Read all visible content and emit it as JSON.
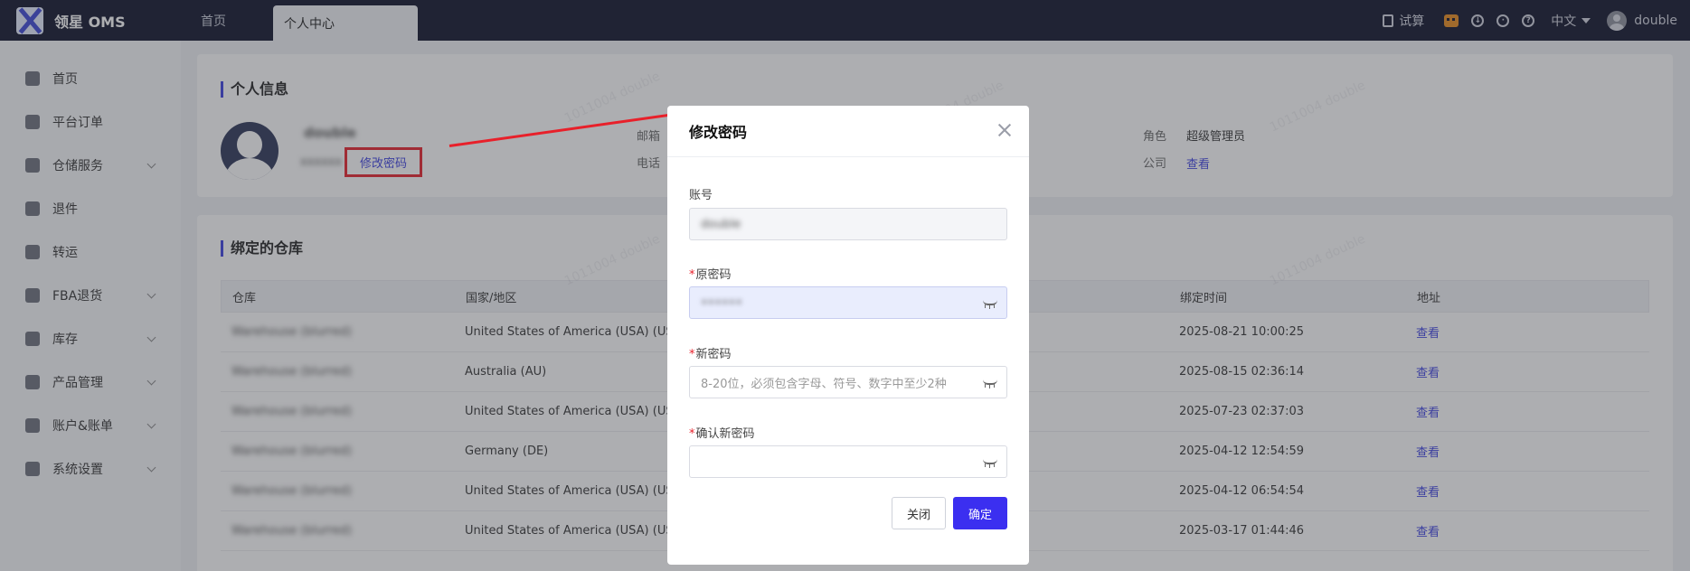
{
  "app": {
    "name": "领星 OMS"
  },
  "tabs": [
    {
      "label": "首页"
    },
    {
      "label": "个人中心"
    }
  ],
  "topbar": {
    "calc": "试算",
    "lang": "中文",
    "user": "double"
  },
  "sidebar": {
    "items": [
      {
        "label": "首页",
        "icon": "home-icon"
      },
      {
        "label": "平台订单",
        "icon": "order-icon"
      },
      {
        "label": "仓储服务",
        "icon": "warehouse-icon"
      },
      {
        "label": "退件",
        "icon": "return-icon"
      },
      {
        "label": "转运",
        "icon": "transfer-icon"
      },
      {
        "label": "FBA退货",
        "icon": "fba-icon"
      },
      {
        "label": "库存",
        "icon": "inventory-icon"
      },
      {
        "label": "产品管理",
        "icon": "product-icon"
      },
      {
        "label": "账户&账单",
        "icon": "billing-icon"
      },
      {
        "label": "系统设置",
        "icon": "settings-icon"
      }
    ]
  },
  "profile": {
    "title": "个人信息",
    "username": "double",
    "account": "xxxxxx",
    "change_password": "修改密码",
    "email_label": "邮箱",
    "phone_label": "电话",
    "role_label": "角色",
    "role_value": "超级管理员",
    "company_label": "公司",
    "company_link": "查看"
  },
  "warehouses": {
    "title": "绑定的仓库",
    "columns": [
      "仓库",
      "国家/地区",
      "绑定时间",
      "地址"
    ],
    "rows": [
      {
        "name": "Warehouse (blurred)",
        "country": "United States of America (USA) (US)",
        "time": "2025-08-21 10:00:25",
        "addr": "查看"
      },
      {
        "name": "Warehouse (blurred)",
        "country": "Australia (AU)",
        "time": "2025-08-15 02:36:14",
        "addr": "查看"
      },
      {
        "name": "Warehouse (blurred)",
        "country": "United States of America (USA) (US)",
        "time": "2025-07-23 02:37:03",
        "addr": "查看"
      },
      {
        "name": "Warehouse (blurred)",
        "country": "Germany (DE)",
        "time": "2025-04-12 12:54:59",
        "addr": "查看"
      },
      {
        "name": "Warehouse (blurred)",
        "country": "United States of America (USA) (US)",
        "time": "2025-04-12 06:54:54",
        "addr": "查看"
      },
      {
        "name": "Warehouse (blurred)",
        "country": "United States of America (USA) (US)",
        "time": "2025-03-17 01:44:46",
        "addr": "查看"
      }
    ]
  },
  "modal": {
    "title": "修改密码",
    "account_label": "账号",
    "account_value": "double",
    "old_label": "原密码",
    "old_value": "••••••",
    "new_label": "新密码",
    "new_placeholder": "8-20位，必须包含字母、符号、数字中至少2种",
    "confirm_label": "确认新密码",
    "btn_close": "关闭",
    "btn_ok": "确定"
  },
  "watermark": "1011004 double"
}
